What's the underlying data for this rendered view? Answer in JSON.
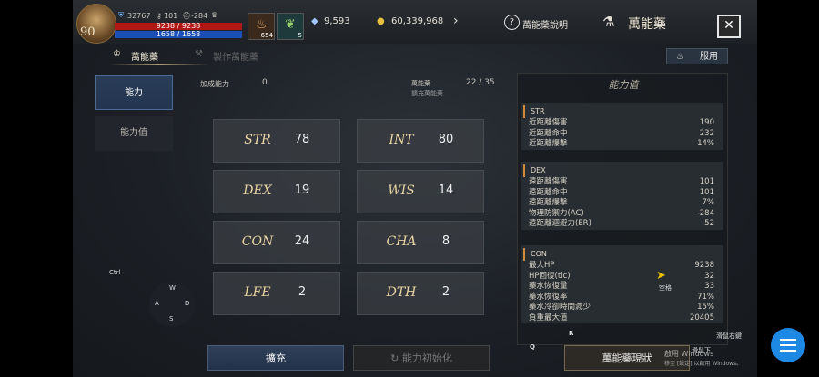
{
  "player": {
    "level": "90",
    "combat_power": "32767",
    "stat_a": "101",
    "stat_b": "-284",
    "hp": "9238 / 9238",
    "mp": "1658 / 1658",
    "slot1_count": "654",
    "slot2_count": "5"
  },
  "currency": {
    "diamonds": "9,593",
    "gold": "60,339,968"
  },
  "header": {
    "help_label": "萬能藥說明",
    "title": "萬能藥",
    "close_label": "✕"
  },
  "tabs": [
    {
      "label": "萬能藥"
    },
    {
      "label": "製作萬能藥"
    }
  ],
  "use_button": "服用",
  "side_menu": [
    {
      "label": "能力"
    },
    {
      "label": "能力值"
    }
  ],
  "info": {
    "bonus_label": "加成能力",
    "bonus_value": "0",
    "elixir_label": "萬能藥",
    "elixir_sub": "擴充萬能藥",
    "elixir_count": "22 / 35"
  },
  "stats": [
    {
      "name": "STR",
      "value": "78"
    },
    {
      "name": "INT",
      "value": "80"
    },
    {
      "name": "DEX",
      "value": "19"
    },
    {
      "name": "WIS",
      "value": "14"
    },
    {
      "name": "CON",
      "value": "24"
    },
    {
      "name": "CHA",
      "value": "8"
    },
    {
      "name": "LFE",
      "value": "2"
    },
    {
      "name": "DTH",
      "value": "2"
    }
  ],
  "ability_panel": {
    "title": "能力值",
    "groups": [
      {
        "name": "STR",
        "rows": [
          {
            "k": "近距離傷害",
            "v": "190"
          },
          {
            "k": "近距離命中",
            "v": "232"
          },
          {
            "k": "近距離爆擊",
            "v": "14%"
          }
        ]
      },
      {
        "name": "DEX",
        "rows": [
          {
            "k": "遠距離傷害",
            "v": "101"
          },
          {
            "k": "遠距離命中",
            "v": "101"
          },
          {
            "k": "遠距離爆擊",
            "v": "7%"
          },
          {
            "k": "物理防禦力(AC)",
            "v": "-284"
          },
          {
            "k": "遠距離迴避力(ER)",
            "v": "52"
          }
        ]
      },
      {
        "name": "CON",
        "rows": [
          {
            "k": "最大HP",
            "v": "9238"
          },
          {
            "k": "HP回復(tic)",
            "v": "32"
          },
          {
            "k": "藥水恢復量",
            "v": "33"
          },
          {
            "k": "藥水恢復率",
            "v": "71%"
          },
          {
            "k": "藥水冷卻時間減少",
            "v": "15%"
          },
          {
            "k": "負重最大值",
            "v": "20405"
          }
        ]
      }
    ]
  },
  "bottom_buttons": {
    "expand": "擴充",
    "reset": "能力初始化",
    "status": "萬能藥現狀"
  },
  "overlay": {
    "ctrl": "Ctrl",
    "w": "W",
    "a": "A",
    "s": "S",
    "d": "D",
    "q": "Q",
    "r": "R",
    "space": "空格",
    "slide_right": "滑鼠右鍵",
    "mouse_scroll": "滑鼠下",
    "win_line1": "啟用 Windows",
    "win_line2": "移至 [設定] 以啟用 Windows。"
  }
}
